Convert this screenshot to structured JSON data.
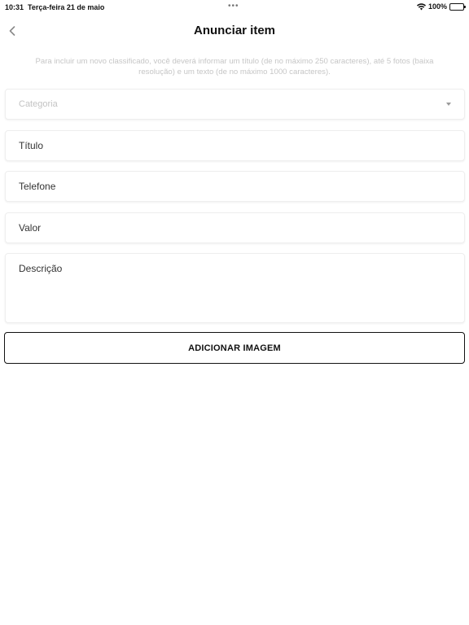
{
  "status_bar": {
    "time": "10:31",
    "date": "Terça-feira 21 de maio",
    "dots": "•••",
    "battery": "100%"
  },
  "nav": {
    "back_icon": "chevron-left-icon",
    "title": "Anunciar item"
  },
  "info": {
    "text": "Para incluir um novo classificado, você deverá informar um título (de no máximo 250 caracteres), até 5 fotos (baixa resolução) e um texto (de no máximo 1000 caracteres)."
  },
  "form": {
    "category_placeholder": "Categoria",
    "title_placeholder": "Título",
    "phone_placeholder": "Telefone",
    "value_placeholder": "Valor",
    "description_placeholder": "Descrição",
    "add_image_label": "ADICIONAR IMAGEM"
  },
  "colors": {
    "accent": "#111111",
    "muted_text": "#c6c6c6",
    "field_border": "#eeeeee"
  }
}
